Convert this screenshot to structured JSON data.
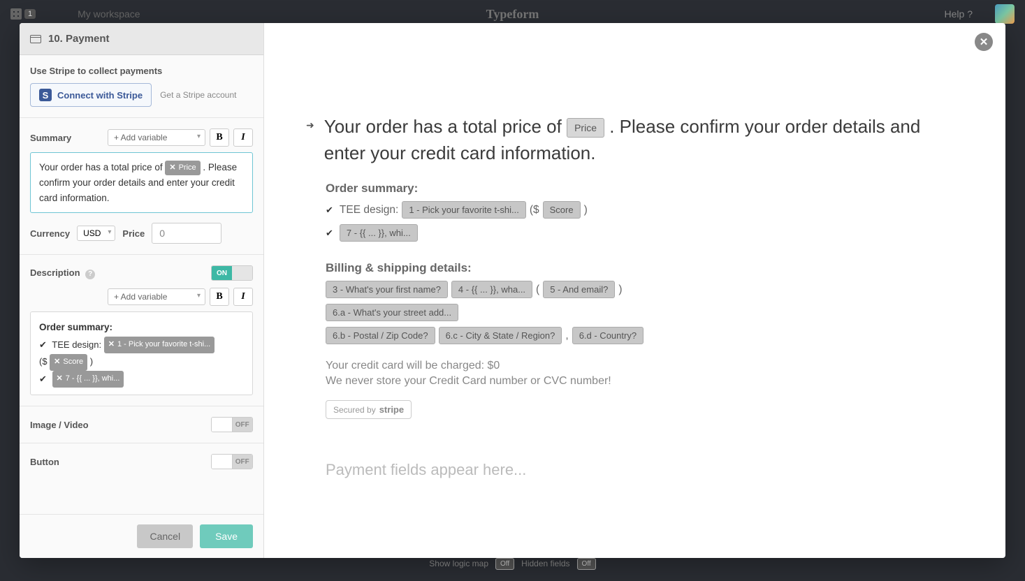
{
  "bg": {
    "workspace": "My workspace",
    "badge": "1",
    "brand": "Typeform",
    "help": "Help ?",
    "footer_logic": "Show logic map",
    "footer_hidden": "Hidden fields",
    "off": "Off"
  },
  "header": {
    "title": "10. Payment"
  },
  "stripe": {
    "heading": "Use Stripe to collect payments",
    "connect": "Connect with Stripe",
    "get_account": "Get a Stripe account"
  },
  "summary": {
    "label": "Summary",
    "add_var": "+ Add variable",
    "text_before": "Your order has a total price of ",
    "chip": "Price",
    "text_after": ". Please confirm your order details and enter your credit card information."
  },
  "currency": {
    "label": "Currency",
    "value": "USD",
    "price_label": "Price",
    "price_value": "0"
  },
  "description": {
    "label": "Description",
    "toggle_on": "ON",
    "add_var": "+ Add variable",
    "heading": "Order summary:",
    "chip1": "1 - Pick your favorite t-shi...",
    "tee_label": "TEE design:",
    "chip_score": "Score",
    "chip2": "7 - {{ ... }}, whi..."
  },
  "image_video": {
    "label": "Image / Video",
    "toggle_off": "OFF"
  },
  "button": {
    "label": "Button",
    "toggle_off": "OFF"
  },
  "footer": {
    "cancel": "Cancel",
    "save": "Save"
  },
  "preview": {
    "q_before": "Your order has a total price of ",
    "q_pill": "Price",
    "q_after": ". Please confirm your order details and enter your credit card information.",
    "order_summary": "Order summary:",
    "tee_label": "TEE design:",
    "tag_tee": "1 - Pick your favorite t-shi...",
    "tag_score": "Score",
    "tag_q7": "7 - {{ ... }}, whi...",
    "billing_head": "Billing & shipping details:",
    "tag_q3": "3 - What's your first name?",
    "tag_q4": "4 - {{ ... }}, wha...",
    "tag_q5": "5 - And email?",
    "tag_q6a": "6.a - What's your street add...",
    "tag_q6b": "6.b - Postal / Zip Code?",
    "tag_q6c": "6.c - City & State / Region?",
    "tag_q6d": "6.d - Country?",
    "charge1": "Your credit card will be charged: $0",
    "charge2": "We never store your Credit Card number or CVC number!",
    "secured_prefix": "Secured by",
    "secured_brand": "stripe",
    "placeholder": "Payment fields appear here..."
  }
}
